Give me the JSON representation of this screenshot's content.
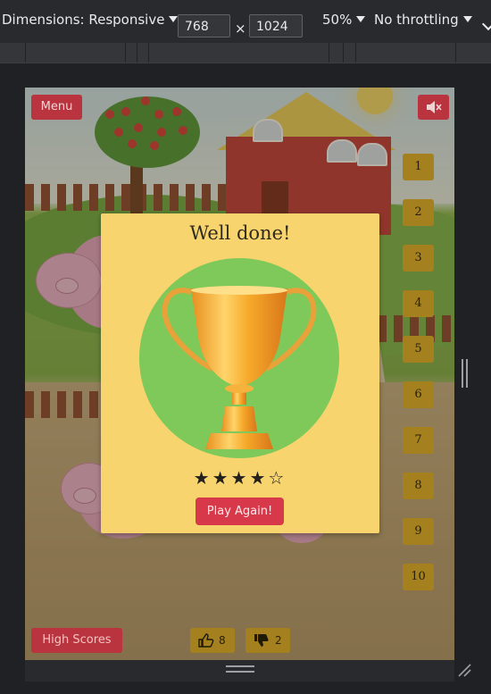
{
  "devtools": {
    "dimensions_label": "Dimensions: Responsive",
    "width_value": "768",
    "times_sign": "×",
    "height_value": "1024",
    "zoom": "50%",
    "throttling": "No throttling"
  },
  "game": {
    "menu_label": "Menu",
    "mute_icon": "speaker-muted-icon",
    "levels": [
      "1",
      "2",
      "3",
      "4",
      "5",
      "6",
      "7",
      "8",
      "9",
      "10"
    ],
    "high_scores_label": "High Scores",
    "likes_count": "8",
    "dislikes_count": "2"
  },
  "modal": {
    "title": "Well done!",
    "stars_text": "★★★★☆",
    "rating": 4,
    "rating_max": 5,
    "play_again_label": "Play Again!"
  },
  "colors": {
    "devtools_bg": "#292a2d",
    "modal_bg": "#f7d46d",
    "trophy_circle": "#7ec95a",
    "red_button": "#b9343e",
    "play_button": "#d8394a",
    "level_button": "#a4801f"
  }
}
